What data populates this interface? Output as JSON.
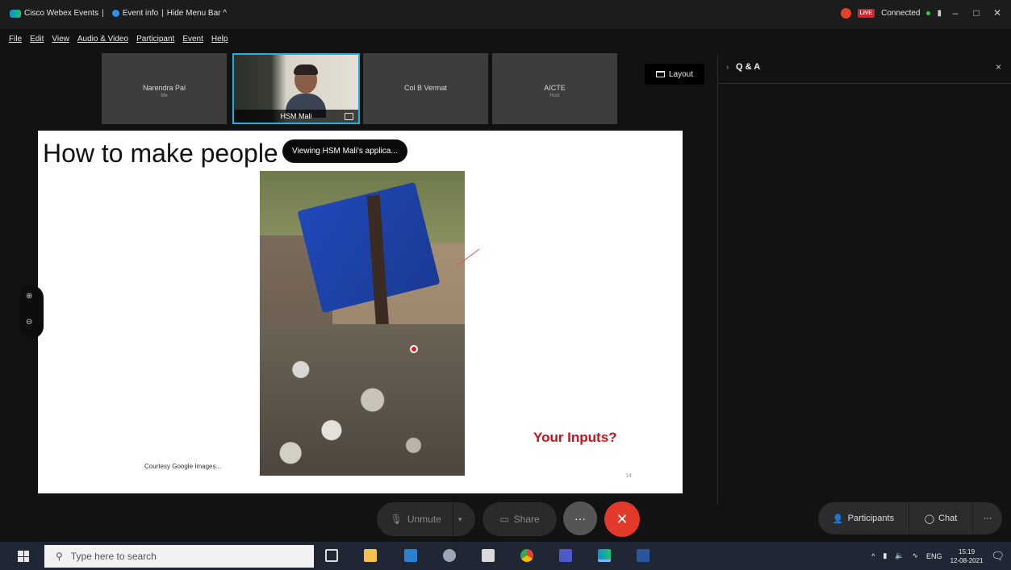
{
  "titlebar": {
    "app_name": "Cisco Webex Events",
    "event_info": "Event info",
    "hide_menu": "Hide Menu Bar ^",
    "status": "Connected",
    "live_label": "LIVE",
    "min": "–",
    "max": "□",
    "close": "✕"
  },
  "menu": [
    "File",
    "Edit",
    "View",
    "Audio & Video",
    "Participant",
    "Event",
    "Help"
  ],
  "participants": [
    {
      "name": "Narendra Pal",
      "sub": "Me"
    },
    {
      "name": "HSM Mali",
      "sub": ""
    },
    {
      "name": "Col B Vermat",
      "sub": ""
    },
    {
      "name": "AICTE",
      "sub": "Host"
    }
  ],
  "layout_label": "Layout",
  "panel": {
    "title": "Q & A",
    "close": "×"
  },
  "slide": {
    "title": "How to make people",
    "viewing_badge": "Viewing HSM Mali's applica...",
    "courtesy": "Courtesy Google Images...",
    "inputs": "Your Inputs?",
    "page_number": "14"
  },
  "controls": {
    "unmute": "Unmute",
    "share": "Share",
    "more": "···",
    "leave": "✕",
    "participants": "Participants",
    "chat": "Chat",
    "panel_more": "···"
  },
  "taskbar": {
    "search_placeholder": "Type here to search",
    "lang": "ENG",
    "time": "15:19",
    "date": "12-08-2021"
  },
  "colors": {
    "accent_border": "#1cb4e8",
    "leave_red": "#e3392b",
    "inputs_red": "#d01018",
    "bin_blue": "#2049b8"
  }
}
